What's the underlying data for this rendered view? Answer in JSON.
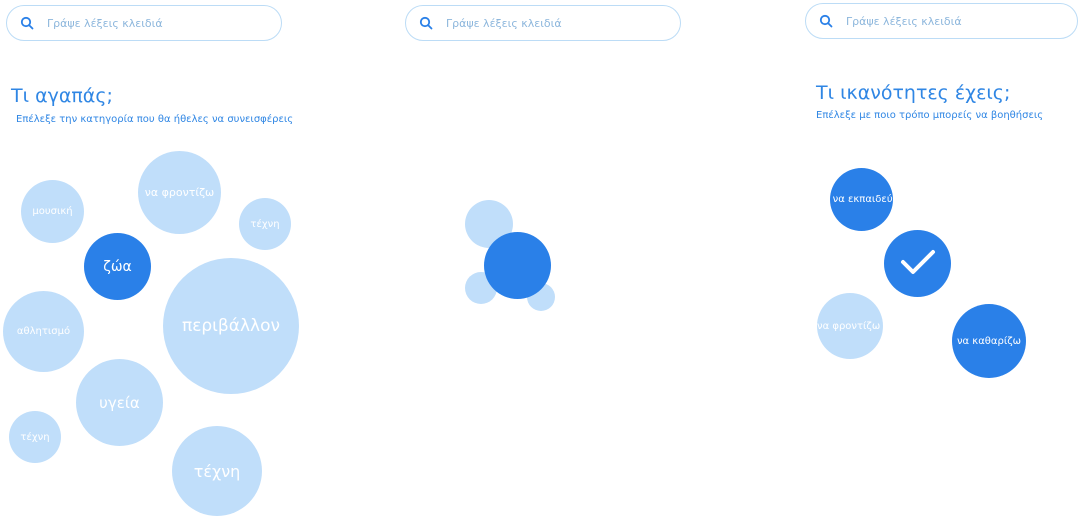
{
  "colors": {
    "accent": "#2f86e4",
    "bubble_light": "#c0defa",
    "bubble_dark": "#2a80e8",
    "search_border": "#bcdcf6"
  },
  "screen1": {
    "search": {
      "placeholder": "Γράψε λέξεις κλειδιά",
      "icon": "search-icon"
    },
    "title": "Τι αγαπάς;",
    "subtitle": "Επέλεξε την κατηγορία που θα ήθελες να συνεισφέρεις",
    "bubbles": [
      {
        "label": "μουσική",
        "selected": false
      },
      {
        "label": "να φροντίζω",
        "selected": false
      },
      {
        "label": "τέχνη",
        "selected": false
      },
      {
        "label": "ζώα",
        "selected": true
      },
      {
        "label": "περιβάλλον",
        "selected": false
      },
      {
        "label": "αθλητισμό",
        "selected": false
      },
      {
        "label": "υγεία",
        "selected": false
      },
      {
        "label": "τέχνη",
        "selected": false
      },
      {
        "label": "τέχνη",
        "selected": false
      }
    ]
  },
  "screen2": {
    "search": {
      "placeholder": "Γράψε λέξεις κλειδιά",
      "icon": "search-icon"
    }
  },
  "screen3": {
    "search": {
      "placeholder": "Γράψε λέξεις κλειδιά",
      "icon": "search-icon"
    },
    "title": "Τι ικανότητες έχεις;",
    "subtitle": "Επέλεξε με ποιο τρόπο μπορείς να βοηθήσεις",
    "bubbles": [
      {
        "label": "να εκπαιδεύω",
        "selected": true
      },
      {
        "label": "να φροντίζω",
        "selected": false
      },
      {
        "label": "να καθαρίζω",
        "selected": true
      }
    ],
    "confirm_icon": "checkmark-icon"
  }
}
